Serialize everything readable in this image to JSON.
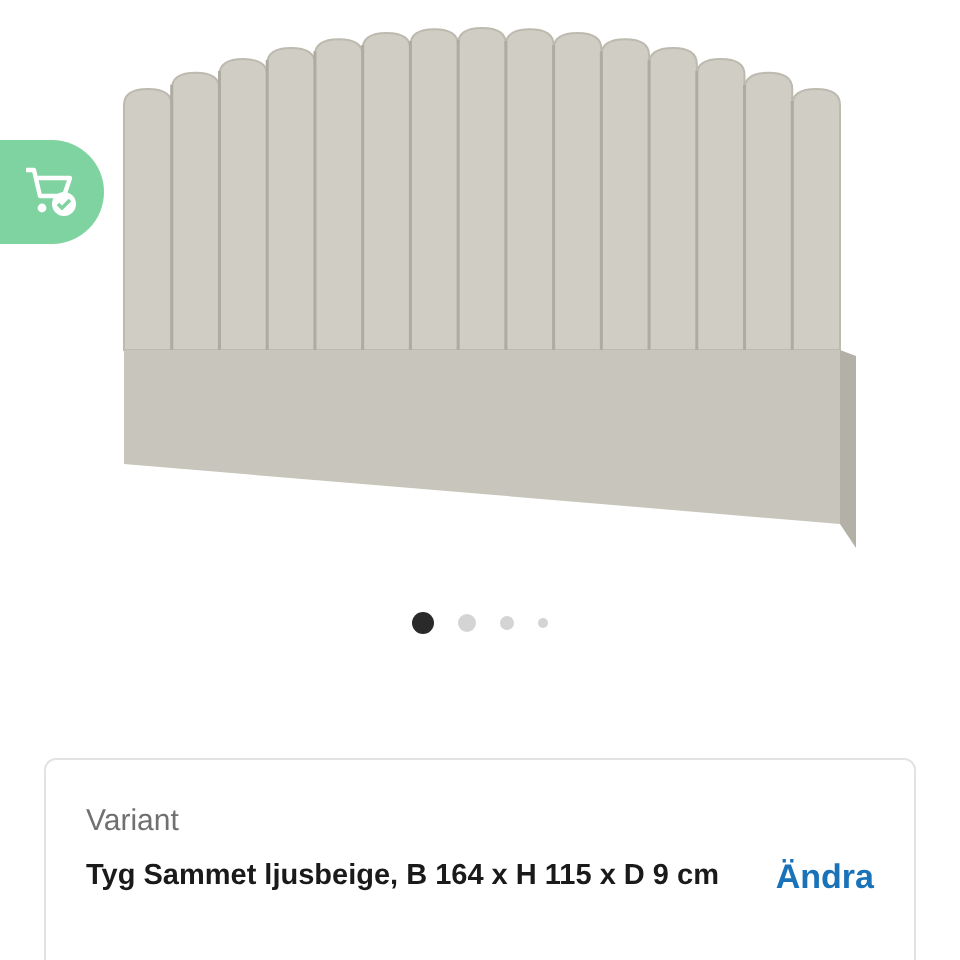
{
  "gallery": {
    "slides": [
      {
        "selected": true
      },
      {
        "selected": false
      },
      {
        "selected": false
      },
      {
        "selected": false
      }
    ]
  },
  "variant": {
    "label": "Variant",
    "value": "Tyg Sammet ljusbeige, B 164 x H 115 x D 9 cm",
    "action": "Ändra"
  }
}
